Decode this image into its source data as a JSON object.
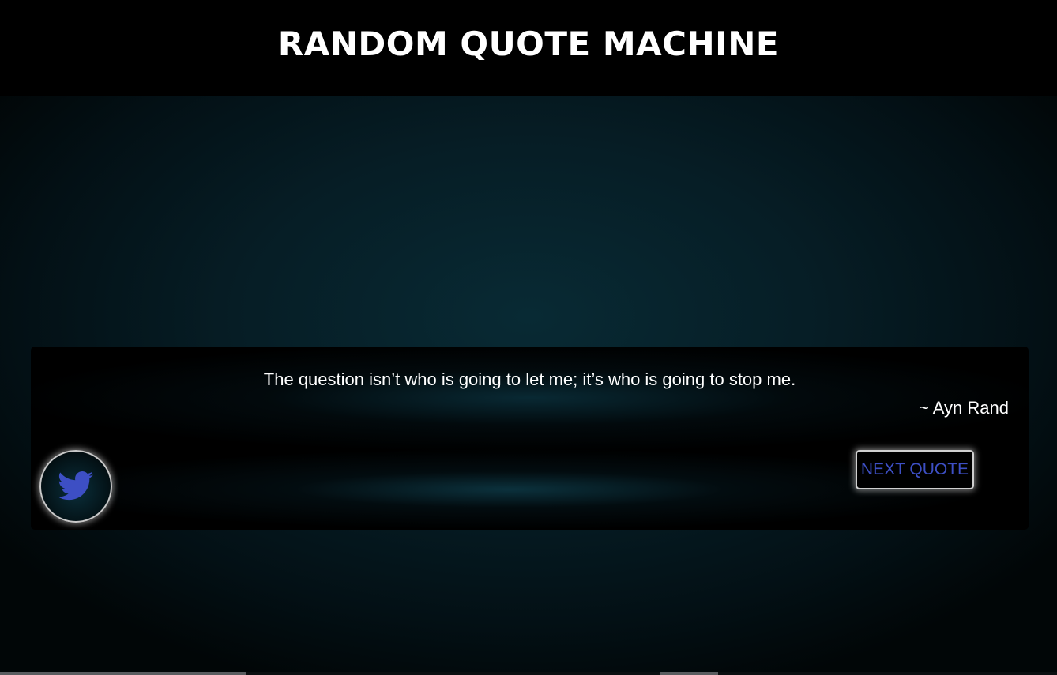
{
  "header": {
    "title": "RANDOM QUOTE MACHINE"
  },
  "quote": {
    "text": "The question isn’t who is going to let me; it’s who is going to stop me.",
    "author": "~ Ayn Rand"
  },
  "actions": {
    "next_label": "NEXT QUOTE",
    "tweet_icon": "twitter-bird-icon"
  },
  "colors": {
    "page_background": "#000000",
    "text": "#ffffff",
    "accent_blue": "#3d4fc4",
    "button_border": "#d0d0d0",
    "glow_teal": "#082a34"
  }
}
